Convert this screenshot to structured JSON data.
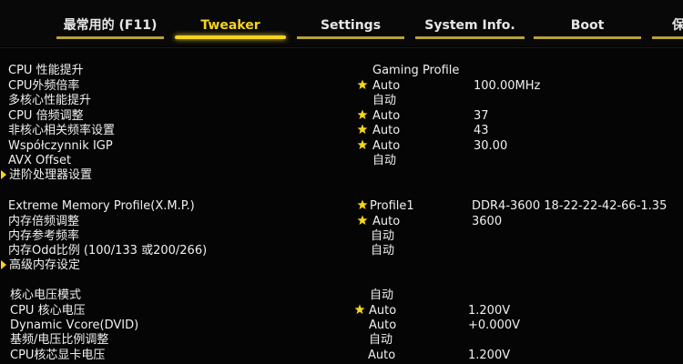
{
  "tabs": [
    {
      "label": "最常用的 (F11)",
      "active": false
    },
    {
      "label": "Tweaker",
      "active": true
    },
    {
      "label": "Settings",
      "active": false
    },
    {
      "label": "System Info.",
      "active": false
    },
    {
      "label": "Boot",
      "active": false
    },
    {
      "label": "保",
      "active": false
    }
  ],
  "rows": [
    {
      "label": "CPU 性能提升",
      "value": "Gaming Profile",
      "current": ""
    },
    {
      "label": "CPU外频倍率",
      "value": "Auto",
      "current": "100.00MHz"
    },
    {
      "label": "多核心性能提升",
      "value": "自动",
      "current": ""
    },
    {
      "label": "CPU 倍频调整",
      "value": "Auto",
      "current": "37"
    },
    {
      "label": "非核心相关频率设置",
      "value": "Auto",
      "current": "43"
    },
    {
      "label": "Współczynnik IGP",
      "value": "Auto",
      "current": "30.00"
    },
    {
      "label": "AVX Offset",
      "value": "自动",
      "current": ""
    },
    {
      "label": "进阶处理器设置",
      "value": "",
      "current": ""
    },
    {
      "label": "Extreme Memory Profile(X.M.P.)",
      "value": "Profile1",
      "current": "DDR4-3600 18-22-22-42-66-1.35"
    },
    {
      "label": "内存倍频调整",
      "value": "Auto",
      "current": "3600"
    },
    {
      "label": "内存参考频率",
      "value": "自动",
      "current": ""
    },
    {
      "label": "内存Odd比例 (100/133 或200/266)",
      "value": "自动",
      "current": ""
    },
    {
      "label": "高级内存设定",
      "value": "",
      "current": ""
    },
    {
      "label": "核心电压模式",
      "value": "自动",
      "current": ""
    },
    {
      "label": "CPU 核心电压",
      "value": "Auto",
      "current": "1.200V"
    },
    {
      "label": "Dynamic Vcore(DVID)",
      "value": "Auto",
      "current": "+0.000V"
    },
    {
      "label": "基频/电压比例调整",
      "value": "自动",
      "current": ""
    },
    {
      "label": "CPU核芯显卡电压",
      "value": "Auto",
      "current": "1.200V"
    }
  ],
  "colors": {
    "accent": "#f4d421",
    "background": "#050505",
    "text": "#f0f0f0"
  },
  "icons": {
    "star": "star-icon",
    "submenu": "submenu-arrow-icon"
  }
}
